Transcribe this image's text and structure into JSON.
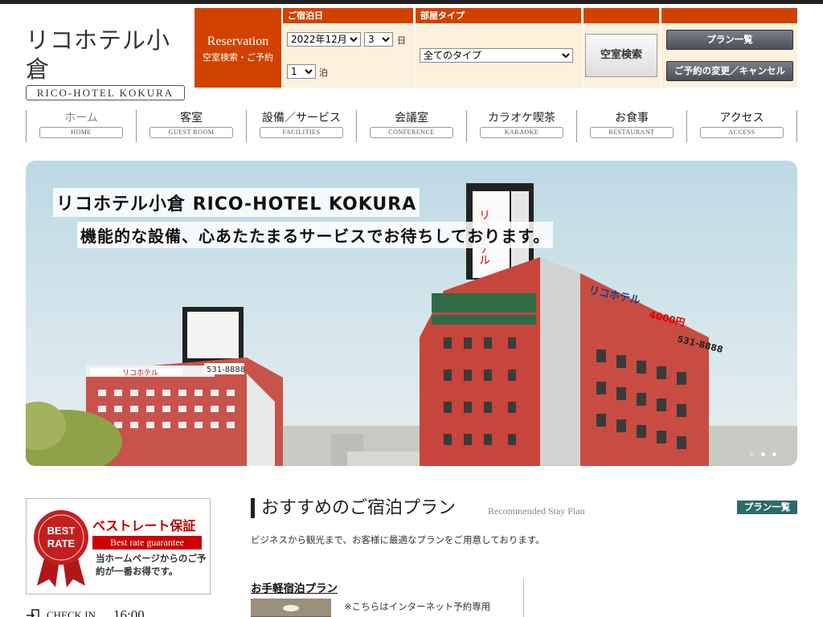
{
  "brand": {
    "name_jp": "リコホテル小倉",
    "name_en": "RICO-HOTEL KOKURA"
  },
  "reservation": {
    "label_en": "Reservation",
    "label_jp": "空室検索・ご予約",
    "checkin_header": "ご宿泊日",
    "room_type_header": "部屋タイプ",
    "year_month": "2022年12月",
    "day": "3",
    "day_unit": "日",
    "nights": "1",
    "nights_unit": "泊",
    "room_type": "全てのタイプ",
    "search_button": "空室検索",
    "plans_button": "プラン一覧",
    "change_button": "ご予約の変更／キャンセル"
  },
  "nav": [
    {
      "jp": "ホーム",
      "en": "HOME"
    },
    {
      "jp": "客室",
      "en": "GUEST ROOM"
    },
    {
      "jp": "設備／サービス",
      "en": "FACILITIES"
    },
    {
      "jp": "会議室",
      "en": "CONFERENCE"
    },
    {
      "jp": "カラオケ喫茶",
      "en": "KARAOKE"
    },
    {
      "jp": "お食事",
      "en": "RESTAURANT"
    },
    {
      "jp": "アクセス",
      "en": "ACCESS"
    }
  ],
  "hero": {
    "title": "リコホテル小倉 RICO-HOTEL KOKURA",
    "tagline": "機能的な設備、心あたたまるサービスでお待ちしております。",
    "sign_main": "リコホテル",
    "sign_price": "4000円",
    "sign_phone": "531-8888",
    "slides_active": 1,
    "slides_total": 3
  },
  "best_rate": {
    "seal_line1": "BEST",
    "seal_line2": "RATE",
    "title": "ベストレート保証",
    "en": "Best rate guarantee",
    "desc": "当ホームページからのご予約が一番お得です。"
  },
  "checkin": {
    "label": "CHECK IN",
    "time": "16:00"
  },
  "plans": {
    "title": "おすすめのご宿泊プラン",
    "subtitle": "Recommended Stay Plan",
    "list_button": "プラン一覧",
    "intro": "ビジネスから観光まで、お客様に最適なプランをご用意しております。",
    "first_plan_title": "お手軽宿泊プラン",
    "first_plan_note": "※こちらはインターネット予約専用"
  },
  "colors": {
    "accent": "#d14200",
    "reservation_bg": "#fdf0dc",
    "plan_button": "#2d6a6a"
  }
}
